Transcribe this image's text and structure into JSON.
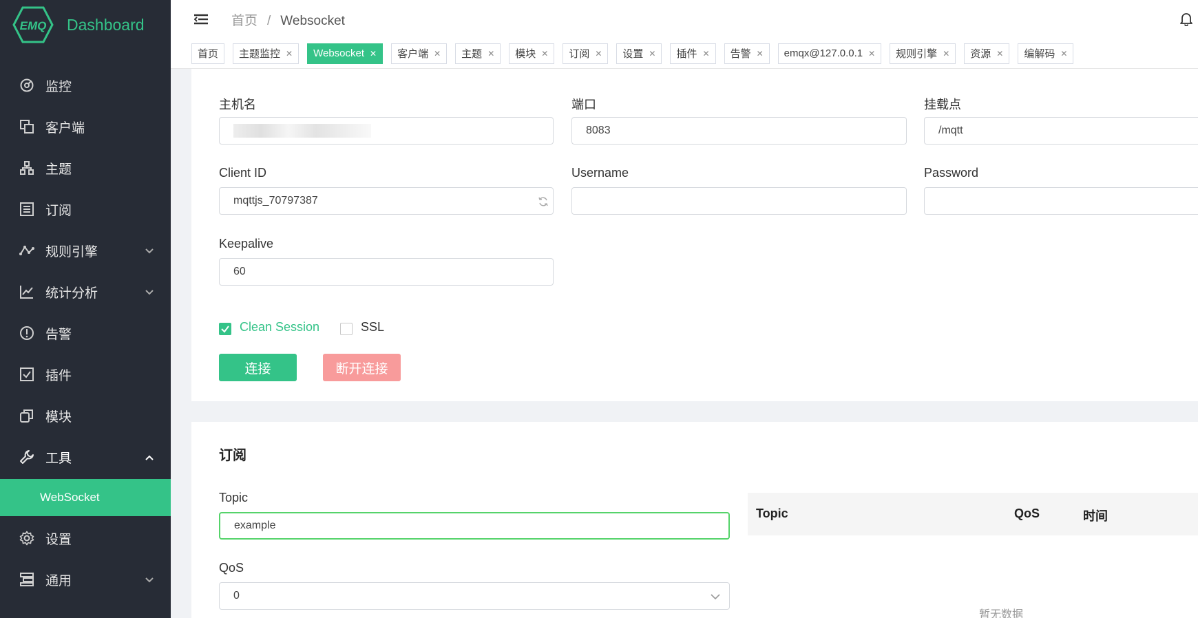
{
  "brand": {
    "logo_text": "EMQ",
    "title": "Dashboard",
    "accent": "#34c388"
  },
  "sidebar": {
    "items": [
      {
        "label": "监控",
        "icon": "gauge-icon"
      },
      {
        "label": "客户端",
        "icon": "clients-icon"
      },
      {
        "label": "主题",
        "icon": "topic-tree-icon"
      },
      {
        "label": "订阅",
        "icon": "list-icon"
      },
      {
        "label": "规则引擎",
        "icon": "rule-graph-icon"
      },
      {
        "label": "统计分析",
        "icon": "chart-icon"
      },
      {
        "label": "告警",
        "icon": "alert-icon"
      },
      {
        "label": "插件",
        "icon": "plugin-check-icon"
      },
      {
        "label": "模块",
        "icon": "module-icon"
      },
      {
        "label": "工具",
        "icon": "wrench-icon"
      },
      {
        "label": "设置",
        "icon": "gear-icon"
      },
      {
        "label": "通用",
        "icon": "general-icon"
      }
    ],
    "sub_active": "WebSocket"
  },
  "header": {
    "crumb_home": "首页",
    "crumb_sep": "/",
    "crumb_current": "Websocket"
  },
  "tabs": [
    {
      "label": "首页",
      "closable": false
    },
    {
      "label": "主题监控",
      "closable": true
    },
    {
      "label": "Websocket",
      "closable": true,
      "active": true
    },
    {
      "label": "客户端",
      "closable": true
    },
    {
      "label": "主题",
      "closable": true
    },
    {
      "label": "模块",
      "closable": true
    },
    {
      "label": "订阅",
      "closable": true
    },
    {
      "label": "设置",
      "closable": true
    },
    {
      "label": "插件",
      "closable": true
    },
    {
      "label": "告警",
      "closable": true
    },
    {
      "label": "emqx@127.0.0.1",
      "closable": true
    },
    {
      "label": "规则引擎",
      "closable": true
    },
    {
      "label": "资源",
      "closable": true
    },
    {
      "label": "编解码",
      "closable": true
    }
  ],
  "connection": {
    "host_label": "主机名",
    "port_label": "端口",
    "port_value": "8083",
    "mount_label": "挂载点",
    "mount_value": "/mqtt",
    "clientid_label": "Client ID",
    "clientid_value": "mqttjs_70797387",
    "username_label": "Username",
    "username_value": "",
    "password_label": "Password",
    "password_value": "",
    "keepalive_label": "Keepalive",
    "keepalive_value": "60",
    "clean_session_label": "Clean Session",
    "ssl_label": "SSL",
    "connect_label": "连接",
    "disconnect_label": "断开连接"
  },
  "subscribe": {
    "title": "订阅",
    "topic_label": "Topic",
    "topic_value": "example",
    "qos_label": "QoS",
    "qos_value": "0",
    "table_headers": [
      "Topic",
      "QoS",
      "时间"
    ],
    "empty_text": "暂无数据"
  }
}
